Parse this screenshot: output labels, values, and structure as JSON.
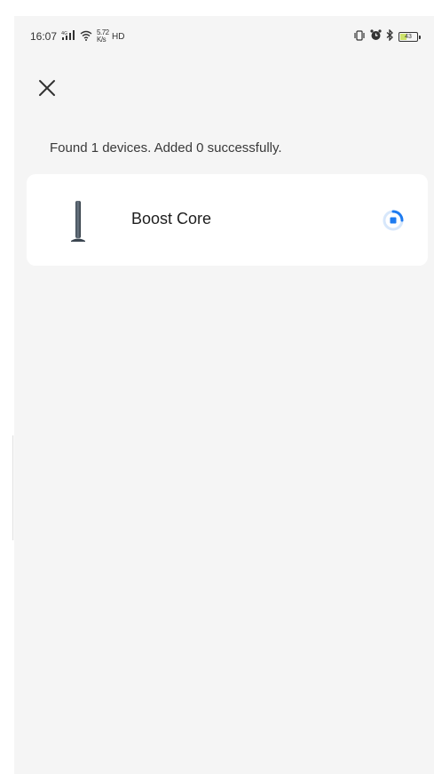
{
  "status_bar": {
    "time": "16:07",
    "net_speed": "5.72 K/s",
    "hd_label": "HD",
    "battery_level": "43",
    "battery_fraction": 0.43,
    "battery_color": "#cde36a"
  },
  "header": {
    "close_icon": "close-icon"
  },
  "scan": {
    "summary": "Found 1 devices. Added 0 successfully."
  },
  "devices": [
    {
      "name": "Boost Core",
      "status_icon": "loading-spinner-icon",
      "accent_color": "#1e7bf0"
    }
  ],
  "colors": {
    "background": "#f5f5f5",
    "card": "#ffffff",
    "accent": "#1e7bf0"
  }
}
